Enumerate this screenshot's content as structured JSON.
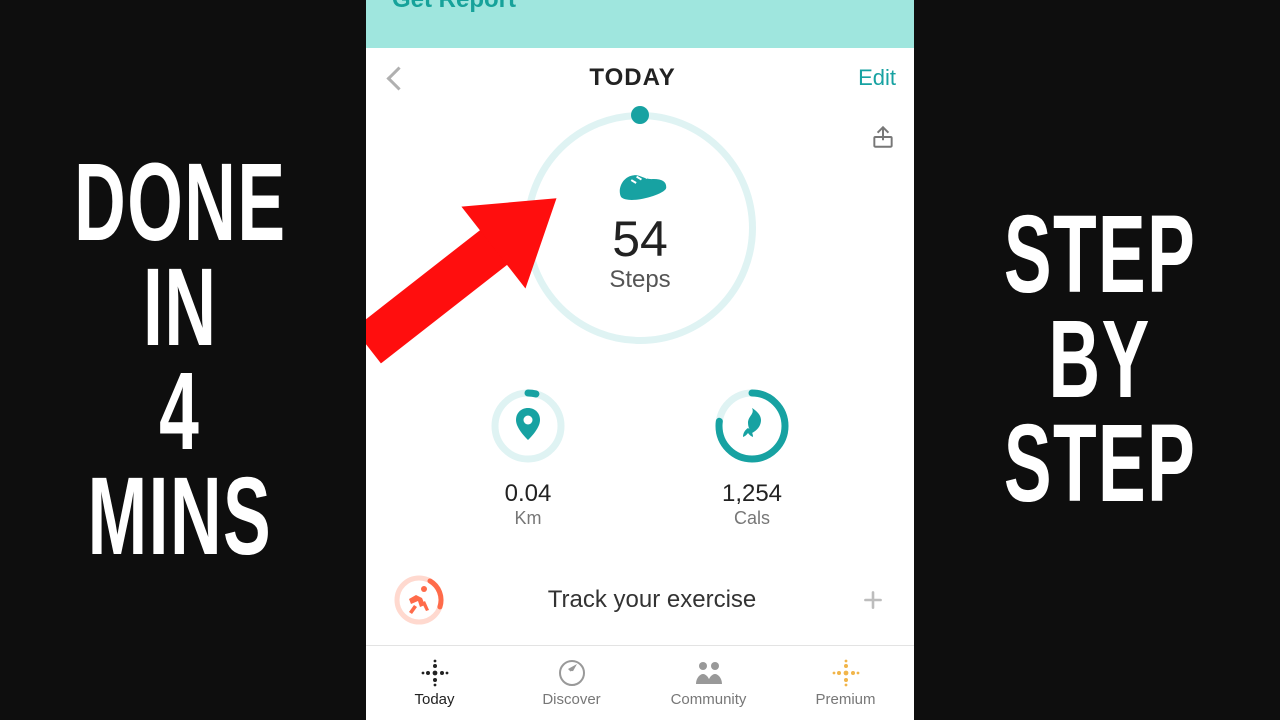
{
  "overlay": {
    "left": [
      "DONE",
      "IN",
      "4",
      "MINS"
    ],
    "right": [
      "STEP",
      "BY",
      "STEP"
    ]
  },
  "app": {
    "banner_text": "Get Report",
    "nav": {
      "title": "TODAY",
      "edit_label": "Edit"
    },
    "steps": {
      "value": "54",
      "label": "Steps"
    },
    "distance": {
      "value": "0.04",
      "label": "Km"
    },
    "calories": {
      "value": "1,254",
      "label": "Cals"
    },
    "exercise_row": "Track your exercise",
    "tabs": [
      {
        "id": "today",
        "label": "Today",
        "active": true
      },
      {
        "id": "discover",
        "label": "Discover",
        "active": false
      },
      {
        "id": "community",
        "label": "Community",
        "active": false
      },
      {
        "id": "premium",
        "label": "Premium",
        "active": false
      }
    ],
    "colors": {
      "teal": "#17a2a2",
      "coral": "#ff6b4a",
      "gold": "#f1b54a"
    }
  }
}
